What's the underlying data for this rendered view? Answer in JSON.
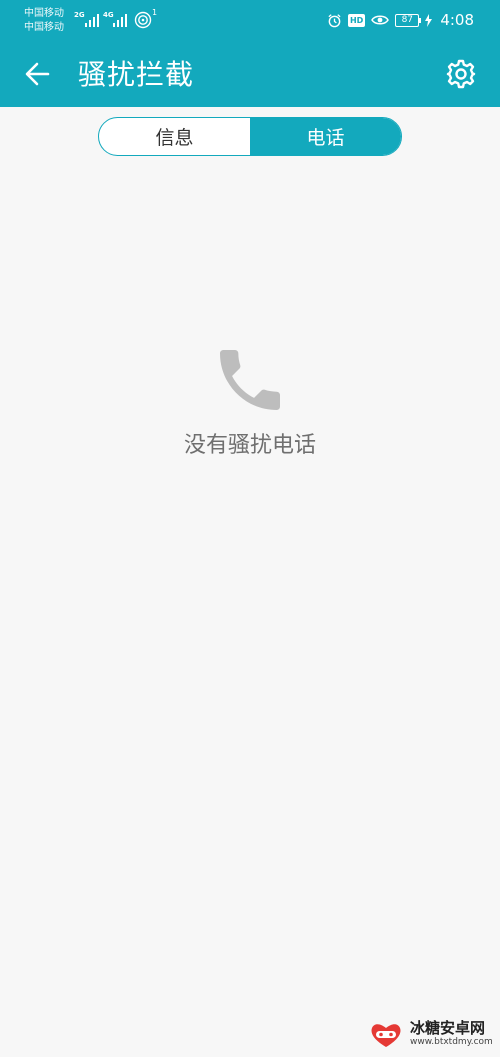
{
  "status_bar": {
    "carrier_1": "中国移动",
    "carrier_2": "中国移动",
    "net_1": "2G",
    "net_2": "4G",
    "wifi_badge": "1",
    "hd": "HD",
    "battery": "87",
    "time": "4:08"
  },
  "app_bar": {
    "title": "骚扰拦截",
    "back_icon": "arrow-left-icon",
    "settings_icon": "gear-icon"
  },
  "tabs": [
    {
      "label": "信息",
      "active": false
    },
    {
      "label": "电话",
      "active": true
    }
  ],
  "empty_state": {
    "icon": "phone-icon",
    "text": "没有骚扰电话"
  },
  "watermark": {
    "title": "冰糖安卓网",
    "url": "www.btxtdmy.com"
  },
  "colors": {
    "accent": "#13a9bd",
    "background": "#f7f7f7",
    "empty_icon": "#bdbdbd",
    "empty_text": "#6f6f6f"
  }
}
